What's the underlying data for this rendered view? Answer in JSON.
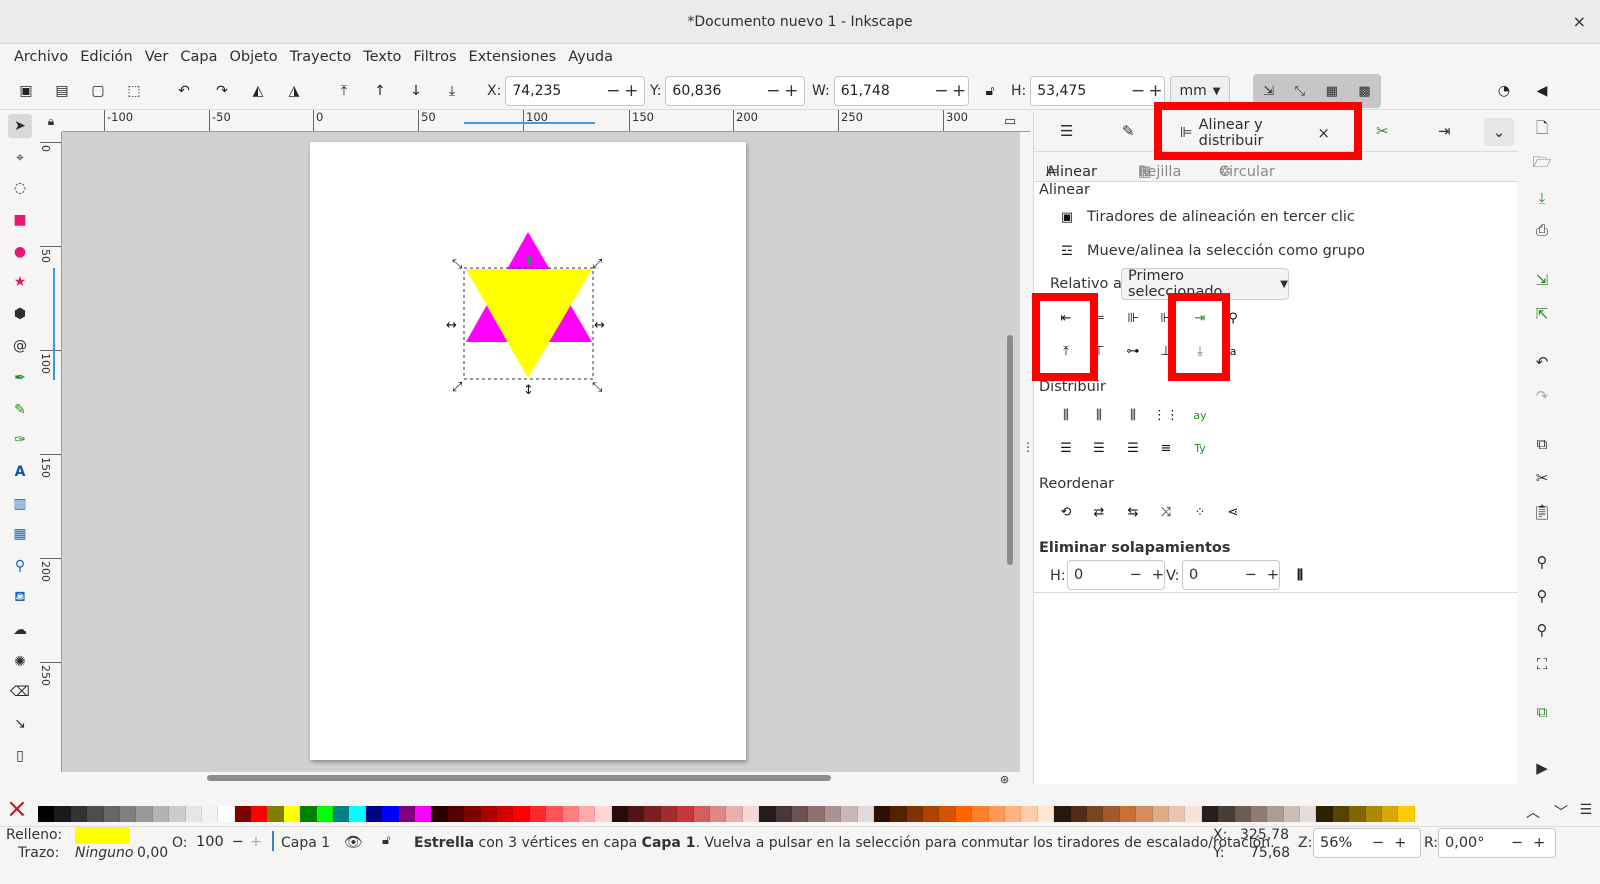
{
  "window": {
    "title": "*Documento nuevo 1 - Inkscape",
    "close": "×"
  },
  "menu": [
    "Archivo",
    "Edición",
    "Ver",
    "Capa",
    "Objeto",
    "Trayecto",
    "Texto",
    "Filtros",
    "Extensiones",
    "Ayuda"
  ],
  "toolbar": {
    "x_label": "X:",
    "x_value": "74,235",
    "y_label": "Y:",
    "y_value": "60,836",
    "w_label": "W:",
    "w_value": "61,748",
    "h_label": "H:",
    "h_value": "53,475",
    "unit": "mm",
    "minus": "−",
    "plus": "+"
  },
  "ruler": {
    "h_ticks": [
      "-100",
      "-50",
      "0",
      "50",
      "100",
      "150",
      "200",
      "250",
      "300"
    ],
    "v_ticks": [
      "0",
      "50",
      "100",
      "150",
      "200",
      "250"
    ]
  },
  "canvas": {
    "star_fill_front": "#ffff00",
    "star_fill_back": "#ff00ff",
    "page_bg": "#ffffff"
  },
  "panel": {
    "active_tab": "Alinear y distribuir",
    "tab_close": "×",
    "subtabs": [
      "Alinear",
      "Rejilla",
      "Circular"
    ],
    "align": {
      "heading": "Alinear",
      "opt1": "Tiradores de alineación en tercer clic",
      "opt2": "Mueve/alinea la selección como grupo",
      "relative_label": "Relativo a:",
      "relative_value": "Primero seleccionado"
    },
    "distribute_heading": "Distribuir",
    "reorder_heading": "Reordenar",
    "overlap": {
      "heading": "Eliminar solapamientos",
      "h_label": "H:",
      "h_value": "0",
      "v_label": "V:",
      "v_value": "0"
    }
  },
  "status": {
    "fill_label": "Relleno:",
    "fill_color": "#ffff00",
    "stroke_label": "Trazo:",
    "stroke_value": "Ninguno",
    "stroke_width": "0,00",
    "opacity_label": "O:",
    "opacity_value": "100",
    "layer": "Capa 1",
    "message_bold": "Estrella",
    "message_mid": " con 3 vértices en capa ",
    "message_layer": "Capa 1",
    "message_rest": ". Vuelva a pulsar en la selección para conmutar los tiradores de escalado/rotación.",
    "cx_label": "X:",
    "cx_value": "325,78",
    "cy_label": "Y:",
    "cy_value": "75,68",
    "zoom_label": "Z:",
    "zoom_value": "56%",
    "rot_label": "R:",
    "rot_value": "0,00°"
  },
  "palette_colors": [
    "#000000",
    "#1a1a1a",
    "#333333",
    "#4d4d4d",
    "#666666",
    "#808080",
    "#999999",
    "#b3b3b3",
    "#cccccc",
    "#e6e6e6",
    "#f2f2f2",
    "#ffffff",
    "#800000",
    "#ff0000",
    "#808000",
    "#ffff00",
    "#008000",
    "#00ff00",
    "#008080",
    "#00ffff",
    "#000080",
    "#0000ff",
    "#800080",
    "#ff00ff",
    "#2b0000",
    "#550000",
    "#800000",
    "#aa0000",
    "#d40000",
    "#ff0000",
    "#ff2a2a",
    "#ff5555",
    "#ff8080",
    "#ffaaaa",
    "#ffd5d5",
    "#280b0b",
    "#501616",
    "#782121",
    "#a02c2c",
    "#c83737",
    "#d35f5f",
    "#de8787",
    "#e9afaf",
    "#f4d7d7",
    "#241c1c",
    "#483737",
    "#6c5353",
    "#916f6f",
    "#ac9393",
    "#c8b7b7",
    "#e3dbdb",
    "#2b1100",
    "#552200",
    "#803300",
    "#aa4400",
    "#d45500",
    "#ff6600",
    "#ff7f2a",
    "#ff9955",
    "#ffb380",
    "#ffccaa",
    "#ffe6d5",
    "#28170b",
    "#502d16",
    "#784421",
    "#a05a2c",
    "#c87137",
    "#d38d5f",
    "#deaa87",
    "#e9c6af",
    "#f4e3d7",
    "#241f1c",
    "#483e37",
    "#6c5d53",
    "#917c6f",
    "#ac9d93",
    "#c8beb7",
    "#e3dedb",
    "#2b2200",
    "#554400",
    "#806600",
    "#aa8800",
    "#d4aa00",
    "#ffcc00"
  ]
}
